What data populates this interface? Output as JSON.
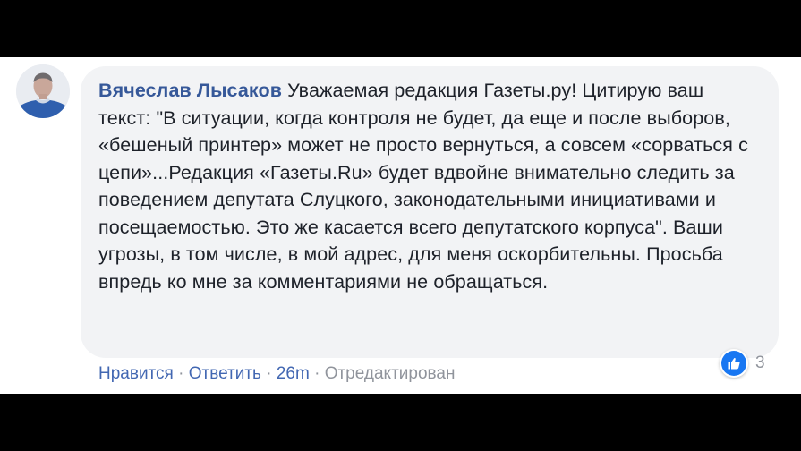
{
  "comment": {
    "author": "Вячеслав Лысаков",
    "text": "Уважаемая редакция Газеты.ру! Цитирую ваш текст: \"В ситуации, когда контроля не будет, да еще и после выборов, «бешеный принтер» может не просто вернуться, а совсем «сорваться с цепи»...Редакция «Газеты.Ru» будет вдвойне внимательно следить за поведением депутата Слуцкого, законодательными инициативами и посещаемостью. Это же касается всего депутатского корпуса\". Ваши угрозы, в том числе, в мой адрес, для меня оскорбительны. Просьба впредь ко мне за комментариями не обращаться."
  },
  "actions": {
    "like_label": "Нравится",
    "reply_label": "Ответить",
    "separator": " · ",
    "time": "26m",
    "edited_label": "Отредактирован"
  },
  "reactions": {
    "icon": "like-icon",
    "count": "3",
    "accent_color": "#1877f2"
  },
  "colors": {
    "author_link": "#365899",
    "action_link": "#4267b2",
    "bubble_bg": "#f2f3f5",
    "muted": "#90949c"
  }
}
